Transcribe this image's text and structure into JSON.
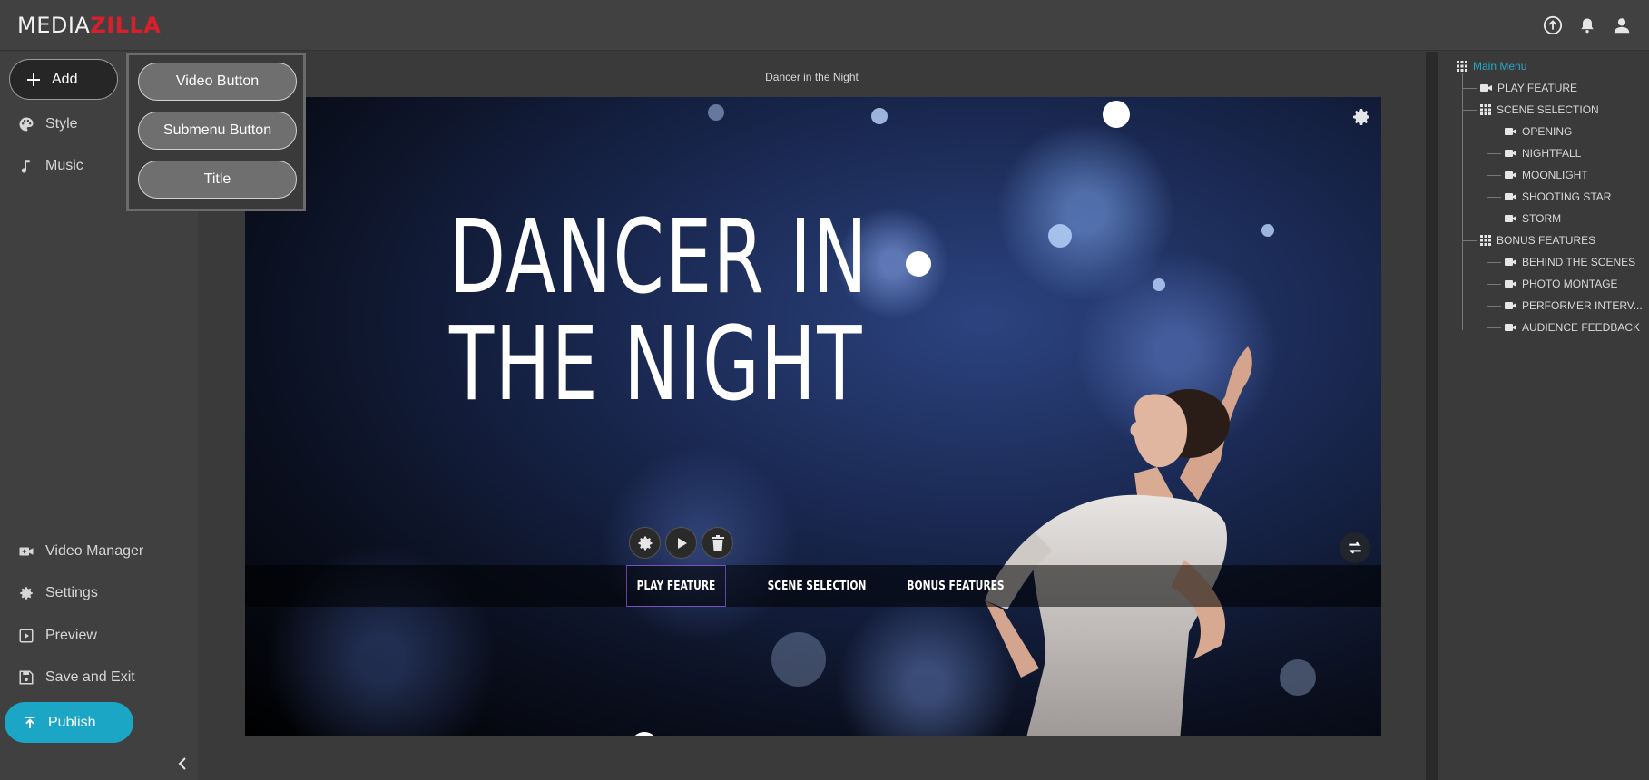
{
  "app": {
    "logo_part1": "MEDIA",
    "logo_part2": "ZILLA",
    "brand_color": "#d8202c",
    "accent_color": "#1aa6c4"
  },
  "topbar": {
    "icons": [
      "upload-circle-icon",
      "bell-icon",
      "user-icon"
    ]
  },
  "sidebar": {
    "add_label": "Add",
    "top_items": [
      {
        "label": "Style",
        "icon": "palette-icon"
      },
      {
        "label": "Music",
        "icon": "music-note-icon"
      }
    ],
    "bottom_items": [
      {
        "label": "Video Manager",
        "icon": "video-plus-icon"
      },
      {
        "label": "Settings",
        "icon": "gear-icon"
      },
      {
        "label": "Preview",
        "icon": "play-square-icon"
      },
      {
        "label": "Save and Exit",
        "icon": "floppy-icon"
      }
    ],
    "publish_label": "Publish"
  },
  "add_popup": {
    "items": [
      "Video Button",
      "Submenu Button",
      "Title"
    ]
  },
  "canvas": {
    "title": "Dancer in the Night",
    "heading": "DANCER IN\nTHE NIGHT",
    "menu_buttons": [
      {
        "label": "PLAY FEATURE",
        "selected": true
      },
      {
        "label": "SCENE SELECTION",
        "selected": false
      },
      {
        "label": "BONUS FEATURES",
        "selected": false
      }
    ]
  },
  "tree": {
    "root": "Main Menu",
    "items": [
      {
        "label": "PLAY FEATURE",
        "type": "video",
        "level": 1
      },
      {
        "label": "SCENE SELECTION",
        "type": "menu",
        "level": 1
      },
      {
        "label": "OPENING",
        "type": "video",
        "level": 2
      },
      {
        "label": "NIGHTFALL",
        "type": "video",
        "level": 2
      },
      {
        "label": "MOONLIGHT",
        "type": "video",
        "level": 2
      },
      {
        "label": "SHOOTING STAR",
        "type": "video",
        "level": 2
      },
      {
        "label": "STORM",
        "type": "video",
        "level": 2
      },
      {
        "label": "BONUS FEATURES",
        "type": "menu",
        "level": 1
      },
      {
        "label": "BEHIND THE SCENES",
        "type": "video",
        "level": 2
      },
      {
        "label": "PHOTO MONTAGE",
        "type": "video",
        "level": 2
      },
      {
        "label": "PERFORMER INTERV...",
        "type": "video",
        "level": 2
      },
      {
        "label": "AUDIENCE FEEDBACK",
        "type": "video",
        "level": 2
      }
    ]
  }
}
